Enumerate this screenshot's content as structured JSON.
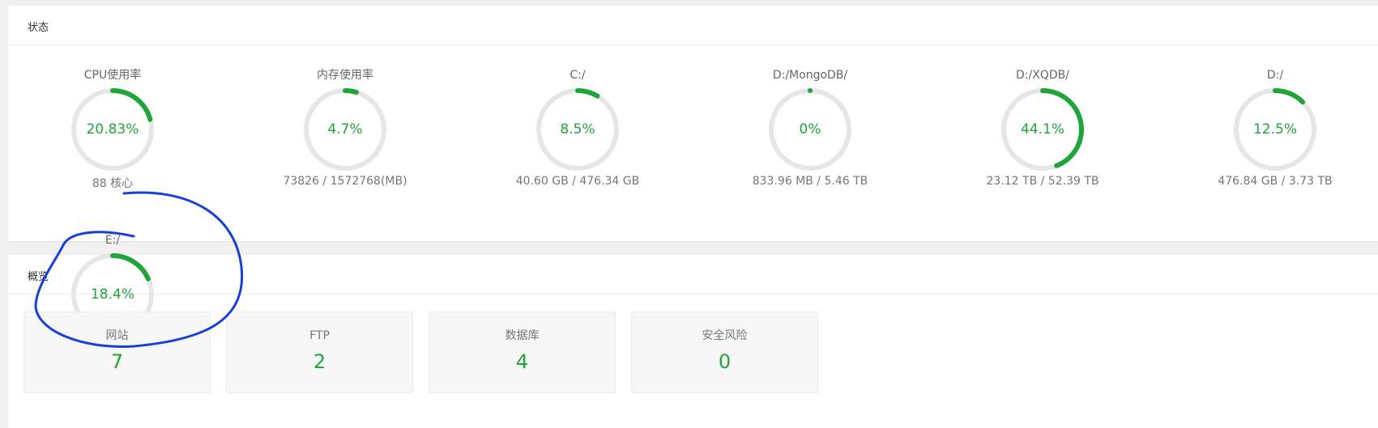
{
  "status_panel": {
    "title": "状态"
  },
  "overview_panel": {
    "title": "概览"
  },
  "accent_color": "#20a53a",
  "track_color": "#e6e6e6",
  "annotation_color": "#1740d9",
  "gauges": [
    {
      "label": "CPU使用率",
      "percent": "20.83%",
      "value": 20.83,
      "detail": "88 核心"
    },
    {
      "label": "内存使用率",
      "percent": "4.7%",
      "value": 4.7,
      "detail": "73826 / 1572768(MB)"
    },
    {
      "label": "C:/",
      "percent": "8.5%",
      "value": 8.5,
      "detail": "40.60 GB / 476.34 GB"
    },
    {
      "label": "D:/MongoDB/",
      "percent": "0%",
      "value": 0,
      "detail": "833.96 MB / 5.46 TB"
    },
    {
      "label": "D:/XQDB/",
      "percent": "44.1%",
      "value": 44.1,
      "detail": "23.12 TB / 52.39 TB"
    },
    {
      "label": "D:/",
      "percent": "12.5%",
      "value": 12.5,
      "detail": "476.84 GB / 3.73 TB"
    },
    {
      "label": "E:/",
      "percent": "18.4%",
      "value": 18.4,
      "detail": ""
    }
  ],
  "cards": [
    {
      "label": "网站",
      "value": "7"
    },
    {
      "label": "FTP",
      "value": "2"
    },
    {
      "label": "数据库",
      "value": "4"
    },
    {
      "label": "安全风险",
      "value": "0"
    }
  ]
}
